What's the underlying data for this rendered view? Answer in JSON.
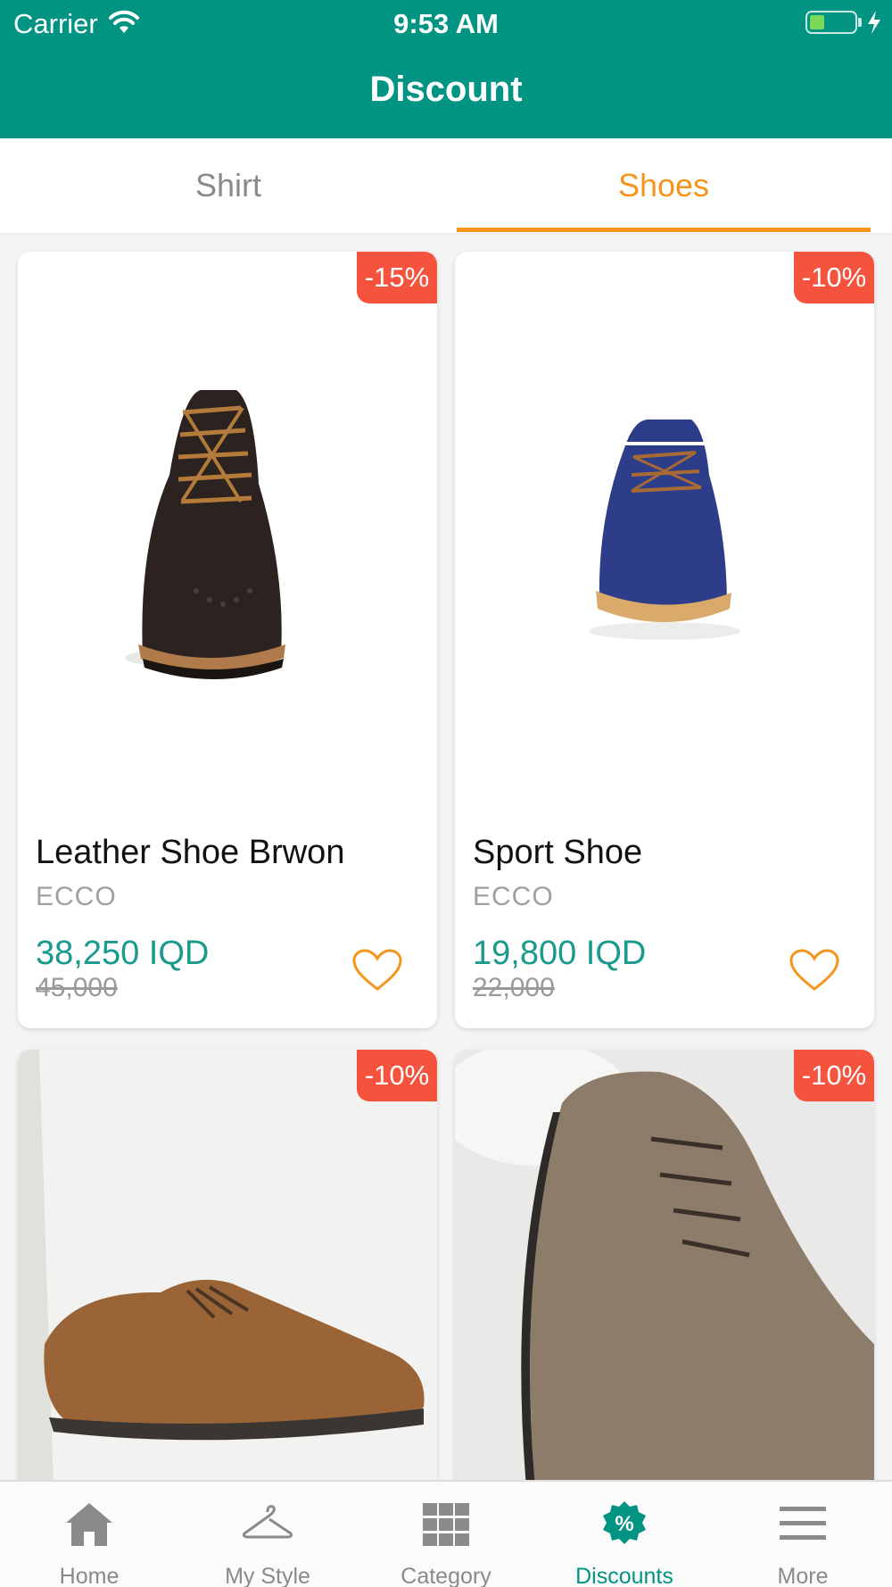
{
  "status_bar": {
    "carrier": "Carrier",
    "time": "9:53 AM"
  },
  "header": {
    "title": "Discount"
  },
  "tabs": [
    {
      "label": "Shirt",
      "selected": false
    },
    {
      "label": "Shoes",
      "selected": true
    }
  ],
  "colors": {
    "header": "#019483",
    "accent": "#f7941d",
    "badge": "#f5533d",
    "price": "#1a9a8c"
  },
  "products": [
    {
      "discount": "-15%",
      "name": "Leather Shoe Brwon",
      "brand": "ECCO",
      "price": "38,250 IQD",
      "old_price": "45,000",
      "image": "dark-brown-brogue-boot"
    },
    {
      "discount": "-10%",
      "name": "Sport Shoe",
      "brand": "ECCO",
      "price": "19,800 IQD",
      "old_price": "22,000",
      "image": "navy-moccasin-sneaker"
    },
    {
      "discount": "-10%",
      "image": "tan-suede-derby-shoe"
    },
    {
      "discount": "-10%",
      "image": "taupe-suede-derby-closeup"
    }
  ],
  "bottom_nav": [
    {
      "label": "Home",
      "icon": "home-icon",
      "active": false
    },
    {
      "label": "My Style",
      "icon": "hanger-icon",
      "active": false
    },
    {
      "label": "Category",
      "icon": "grid-icon",
      "active": false
    },
    {
      "label": "Discounts",
      "icon": "percent-badge-icon",
      "active": true
    },
    {
      "label": "More",
      "icon": "menu-icon",
      "active": false
    }
  ]
}
